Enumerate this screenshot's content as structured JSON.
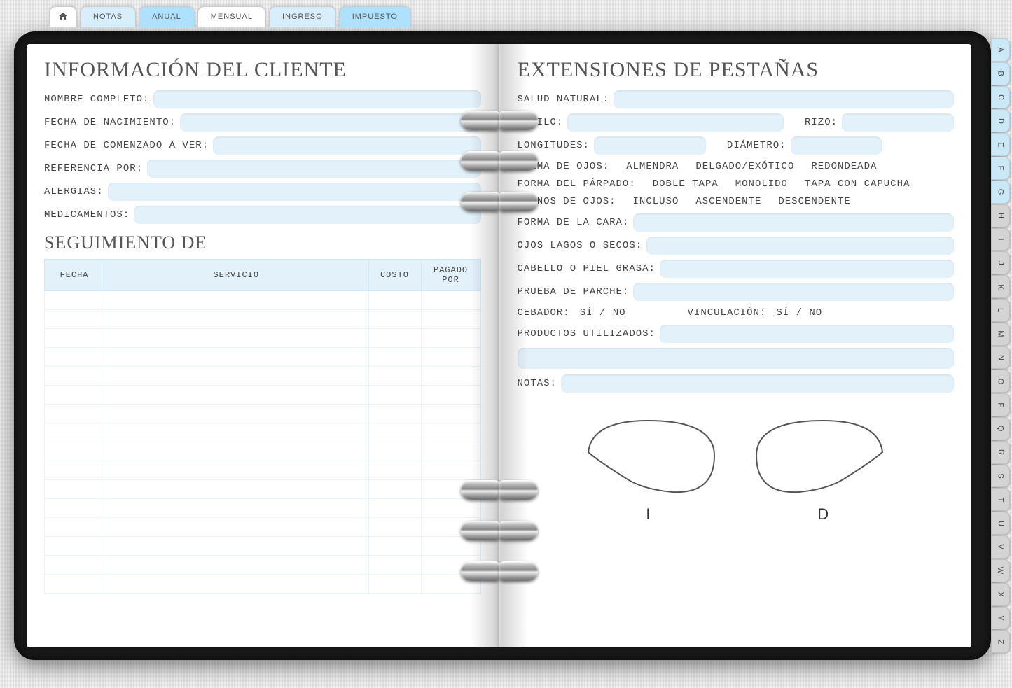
{
  "tabs": {
    "home_icon": "home-icon",
    "items": [
      "NOTAS",
      "ANUAL",
      "MENSUAL",
      "INGRESO",
      "IMPUESTO"
    ]
  },
  "alpha": [
    "A",
    "B",
    "C",
    "D",
    "E",
    "F",
    "G",
    "H",
    "I",
    "J",
    "K",
    "L",
    "M",
    "N",
    "O",
    "P",
    "Q",
    "R",
    "S",
    "T",
    "U",
    "V",
    "W",
    "X",
    "Y",
    "Z"
  ],
  "left": {
    "title": "INFORMACIÓN DEL CLIENTE",
    "fields": {
      "name": "NOMBRE COMPLETO:",
      "dob": "FECHA DE NACIMIENTO:",
      "start": "FECHA DE COMENZADO A VER:",
      "ref": "REFERENCIA POR:",
      "allergies": "ALERGIAS:",
      "meds": "MEDICAMENTOS:"
    },
    "section2": "SEGUIMIENTO DE",
    "columns": [
      "FECHA",
      "SERVICIO",
      "COSTO",
      "PAGADO POR"
    ]
  },
  "right": {
    "title": "EXTENSIONES DE PESTAÑAS",
    "fields": {
      "health": "SALUD NATURAL:",
      "style": "ESTILO:",
      "curl": "RIZO:",
      "lengths": "LONGITUDES:",
      "diameter": "DIÁMETRO:",
      "eye_shape_label": "FORMA DE OJOS:",
      "eye_shape_opts": [
        "ALMENDRA",
        "DELGADO/EXÓTICO",
        "REDONDEADA"
      ],
      "lid_shape_label": "FORMA DEL PÁRPADO:",
      "lid_shape_opts": [
        "DOBLE TAPA",
        "MONOLIDO",
        "TAPA CON CAPUCHA"
      ],
      "eye_plane_label": "PLANOS DE OJOS:",
      "eye_plane_opts": [
        "INCLUSO",
        "ASCENDENTE",
        "DESCENDENTE"
      ],
      "face_shape": "FORMA DE LA CARA:",
      "watery": "OJOS LAGOS O SECOS:",
      "oily": "CABELLO O PIEL GRASA:",
      "patch": "PRUEBA DE PARCHE:",
      "primer_label": "CEBADOR:",
      "primer_opts": "SÍ / NO",
      "bond_label": "VINCULACIÓN:",
      "bond_opts": "SÍ / NO",
      "products": "PRODUCTOS UTILIZADOS:",
      "notes": "NOTAS:"
    },
    "pads": {
      "left": "I",
      "right": "D"
    }
  }
}
